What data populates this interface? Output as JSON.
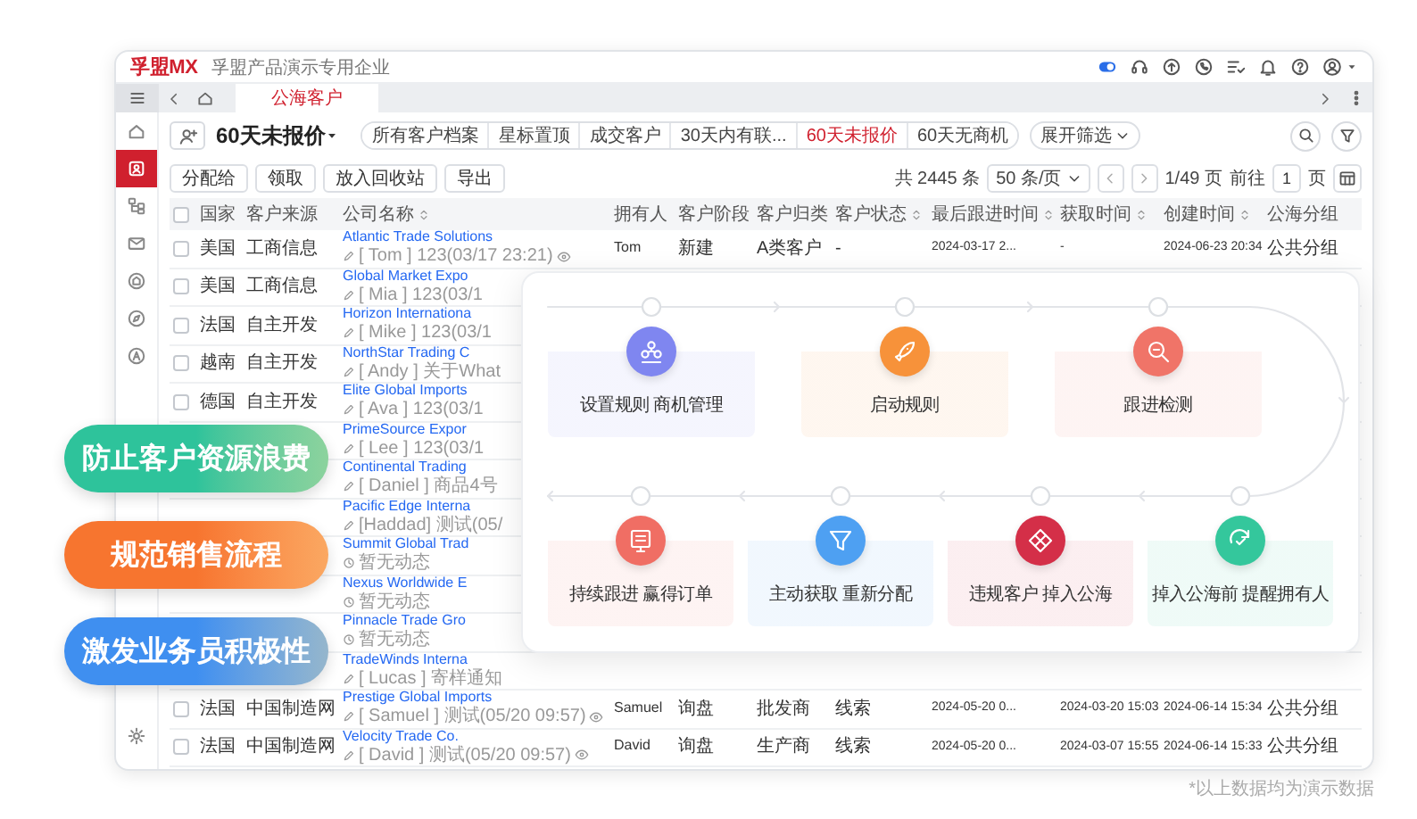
{
  "app": {
    "logo": "孚盟MX",
    "company": "孚盟产品演示专用企业"
  },
  "tabs": [
    {
      "label": "公海客户",
      "selected": true
    }
  ],
  "sidebar": {
    "items": [
      {
        "selected": false
      },
      {
        "selected": true
      },
      {
        "selected": false
      },
      {
        "selected": false
      },
      {
        "selected": false
      },
      {
        "selected": false
      },
      {
        "selected": false
      },
      {
        "selected": false
      }
    ]
  },
  "view": {
    "title": "60天未报价"
  },
  "filters": [
    {
      "label": "所有客户档案",
      "selected": false
    },
    {
      "label": "星标置顶",
      "selected": false
    },
    {
      "label": "成交客户",
      "selected": false
    },
    {
      "label": "30天内有联...",
      "selected": false
    },
    {
      "label": "60天未报价",
      "selected": true
    },
    {
      "label": "60天无商机",
      "selected": false
    }
  ],
  "expand_filter": "展开筛选",
  "actions": [
    "分配给",
    "领取",
    "放入回收站",
    "导出"
  ],
  "pagination": {
    "total": "共 2445 条",
    "page_size": "50 条/页",
    "page": "1/49 页",
    "goto_label": "前往",
    "goto_value": "1",
    "goto_unit": "页"
  },
  "table": {
    "all_checked": false,
    "columns": [
      {
        "label": "国家",
        "kind": "text",
        "sortable": false
      },
      {
        "label": "客户来源",
        "kind": "text",
        "sortable": false
      },
      {
        "label": "公司名称",
        "kind": "company",
        "sortable": true
      },
      {
        "label": "拥有人",
        "kind": "person",
        "sortable": false
      },
      {
        "label": "客户阶段",
        "kind": "text",
        "sortable": false
      },
      {
        "label": "客户归类",
        "kind": "text",
        "sortable": false
      },
      {
        "label": "客户状态",
        "kind": "text",
        "sortable": true
      },
      {
        "label": "最后跟进时间",
        "kind": "date",
        "sortable": true
      },
      {
        "label": "获取时间",
        "kind": "date",
        "sortable": true
      },
      {
        "label": "创建时间",
        "kind": "date",
        "sortable": true
      },
      {
        "label": "公海分组",
        "kind": "text",
        "sortable": false
      }
    ],
    "rows": [
      {
        "checked": false,
        "country": "美国",
        "source": "工商信息",
        "company": {
          "name": "Atlantic Trade Solutions",
          "activity": {
            "kind": "note",
            "text": "[ Tom ] 123(03/17 23:21)",
            "viewable": true
          }
        },
        "details": [
          "Tom",
          "新建",
          "A类客户",
          "-",
          "2024-03-17 2...",
          "-",
          "2024-06-23 20:34",
          "公共分组"
        ]
      },
      {
        "checked": false,
        "country": "美国",
        "source": "工商信息",
        "company": {
          "name": "Global Market Expo",
          "activity": {
            "kind": "note",
            "text": "[ Mia ] 123(03/1",
            "viewable": false
          }
        }
      },
      {
        "checked": false,
        "country": "法国",
        "source": "自主开发",
        "company": {
          "name": "Horizon Internationa",
          "activity": {
            "kind": "note",
            "text": "[ Mike ] 123(03/1",
            "viewable": false
          }
        }
      },
      {
        "checked": false,
        "country": "越南",
        "source": "自主开发",
        "company": {
          "name": "NorthStar Trading C",
          "activity": {
            "kind": "note",
            "text": "[ Andy ] 关于What",
            "viewable": false
          }
        }
      },
      {
        "checked": false,
        "country": "德国",
        "source": "自主开发",
        "company": {
          "name": "Elite Global Imports",
          "activity": {
            "kind": "note",
            "text": "[ Ava ] 123(03/1",
            "viewable": false
          }
        }
      },
      {
        "company": {
          "name": "PrimeSource Expor",
          "activity": {
            "kind": "note",
            "text": "[ Lee ] 123(03/1",
            "viewable": false
          }
        }
      },
      {
        "company": {
          "name": "Continental Trading",
          "activity": {
            "kind": "note",
            "text": "[ Daniel ] 商品4号",
            "viewable": false
          }
        }
      },
      {
        "company": {
          "name": "Pacific Edge Interna",
          "activity": {
            "kind": "note",
            "text": "[Haddad] 测试(05/",
            "viewable": false
          }
        }
      },
      {
        "company": {
          "name": "Summit Global Trad",
          "activity": {
            "kind": "empty",
            "text": "暂无动态",
            "viewable": false
          }
        }
      },
      {
        "company": {
          "name": "Nexus Worldwide E",
          "activity": {
            "kind": "empty",
            "text": "暂无动态",
            "viewable": false
          }
        }
      },
      {
        "company": {
          "name": "Pinnacle Trade Gro",
          "activity": {
            "kind": "empty",
            "text": "暂无动态",
            "viewable": false
          }
        }
      },
      {
        "company": {
          "name": "TradeWinds Interna",
          "activity": {
            "kind": "note",
            "text": "[ Lucas ] 寄样通知",
            "viewable": false
          }
        }
      },
      {
        "checked": false,
        "country": "法国",
        "source": "中国制造网",
        "company": {
          "name": "Prestige Global Imports",
          "activity": {
            "kind": "note",
            "text": "[ Samuel ] 测试(05/20 09:57)",
            "viewable": true
          }
        },
        "details": [
          "Samuel",
          "询盘",
          "批发商",
          "线索",
          "2024-05-20 0...",
          "2024-03-20 15:03",
          "2024-06-14 15:34",
          "公共分组"
        ]
      },
      {
        "checked": false,
        "country": "法国",
        "source": "中国制造网",
        "company": {
          "name": "Velocity Trade Co.",
          "activity": {
            "kind": "note",
            "text": "[ David ] 测试(05/20 09:57)",
            "viewable": true
          }
        },
        "details": [
          "David",
          "询盘",
          "生产商",
          "线索",
          "2024-05-20 0...",
          "2024-03-07 15:55",
          "2024-06-14 15:33",
          "公共分组"
        ]
      }
    ]
  },
  "highlights": [
    {
      "label": "防止客户资源浪费",
      "color": "#2ec39b"
    },
    {
      "label": "规范销售流程",
      "color": "#f7752f"
    },
    {
      "label": "激发业务员积极性",
      "color": "#3f8ff0"
    }
  ],
  "flow": {
    "rows": [
      {
        "steps": [
          {
            "label": "设置规则 商机管理",
            "color": "#7f86f0"
          },
          {
            "label": "启动规则",
            "color": "#f7923a"
          },
          {
            "label": "跟进检测",
            "color": "#f07468"
          }
        ]
      },
      {
        "steps": [
          {
            "label": "持续跟进 赢得订单",
            "color": "#f06e64"
          },
          {
            "label": "主动获取 重新分配",
            "color": "#4ea0f2"
          },
          {
            "label": "违规客户 掉入公海",
            "color": "#d42f48"
          },
          {
            "label": "掉入公海前 提醒拥有人",
            "color": "#34c79c"
          }
        ]
      }
    ]
  },
  "footnote": "*以上数据均为演示数据"
}
